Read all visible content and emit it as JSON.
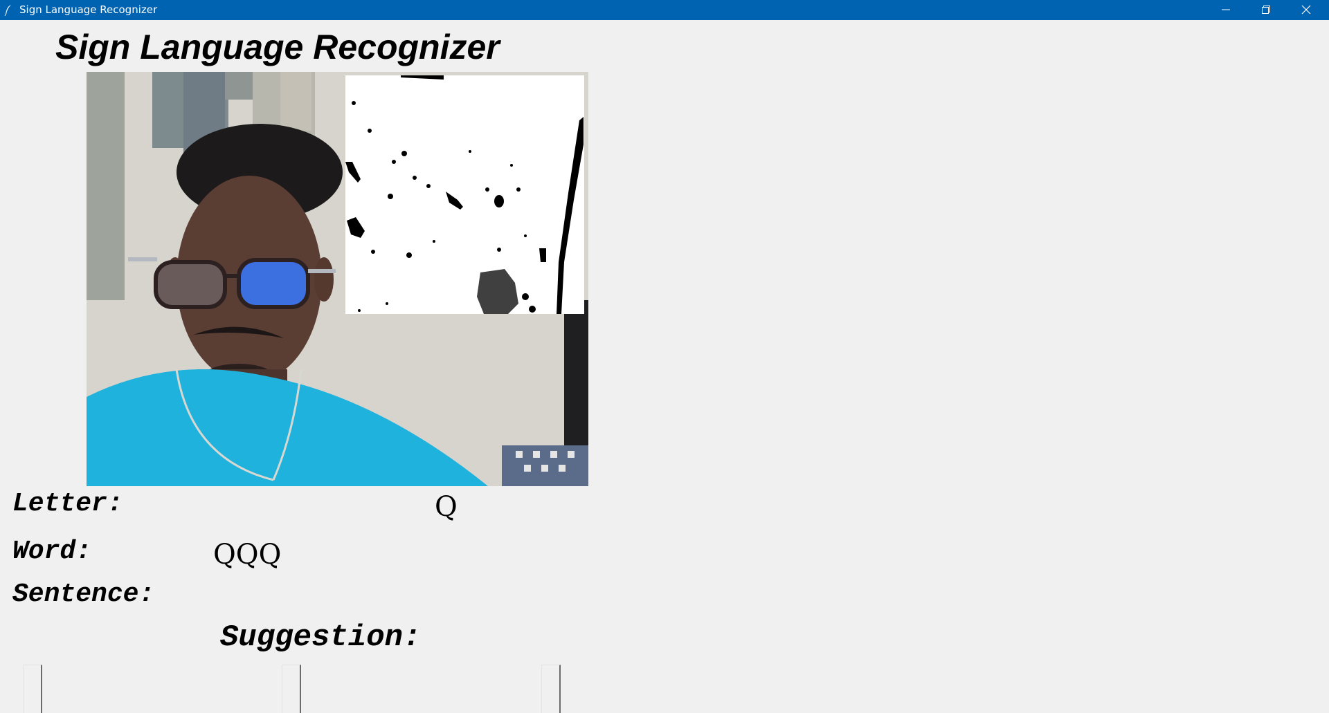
{
  "window": {
    "title": "Sign Language Recognizer",
    "titlebar_color": "#0063b1"
  },
  "app": {
    "heading": "Sign Language Recognizer"
  },
  "labels": {
    "letter": "Letter:",
    "word": "Word:",
    "sentence": "Sentence:",
    "suggestion": "Suggestion:"
  },
  "values": {
    "letter": "Q",
    "word": "QQQ",
    "sentence": ""
  },
  "suggestions": [
    "",
    "",
    ""
  ],
  "icons": {
    "app": "feather-icon",
    "minimize": "minimize-icon",
    "restore": "restore-icon",
    "close": "close-icon"
  }
}
